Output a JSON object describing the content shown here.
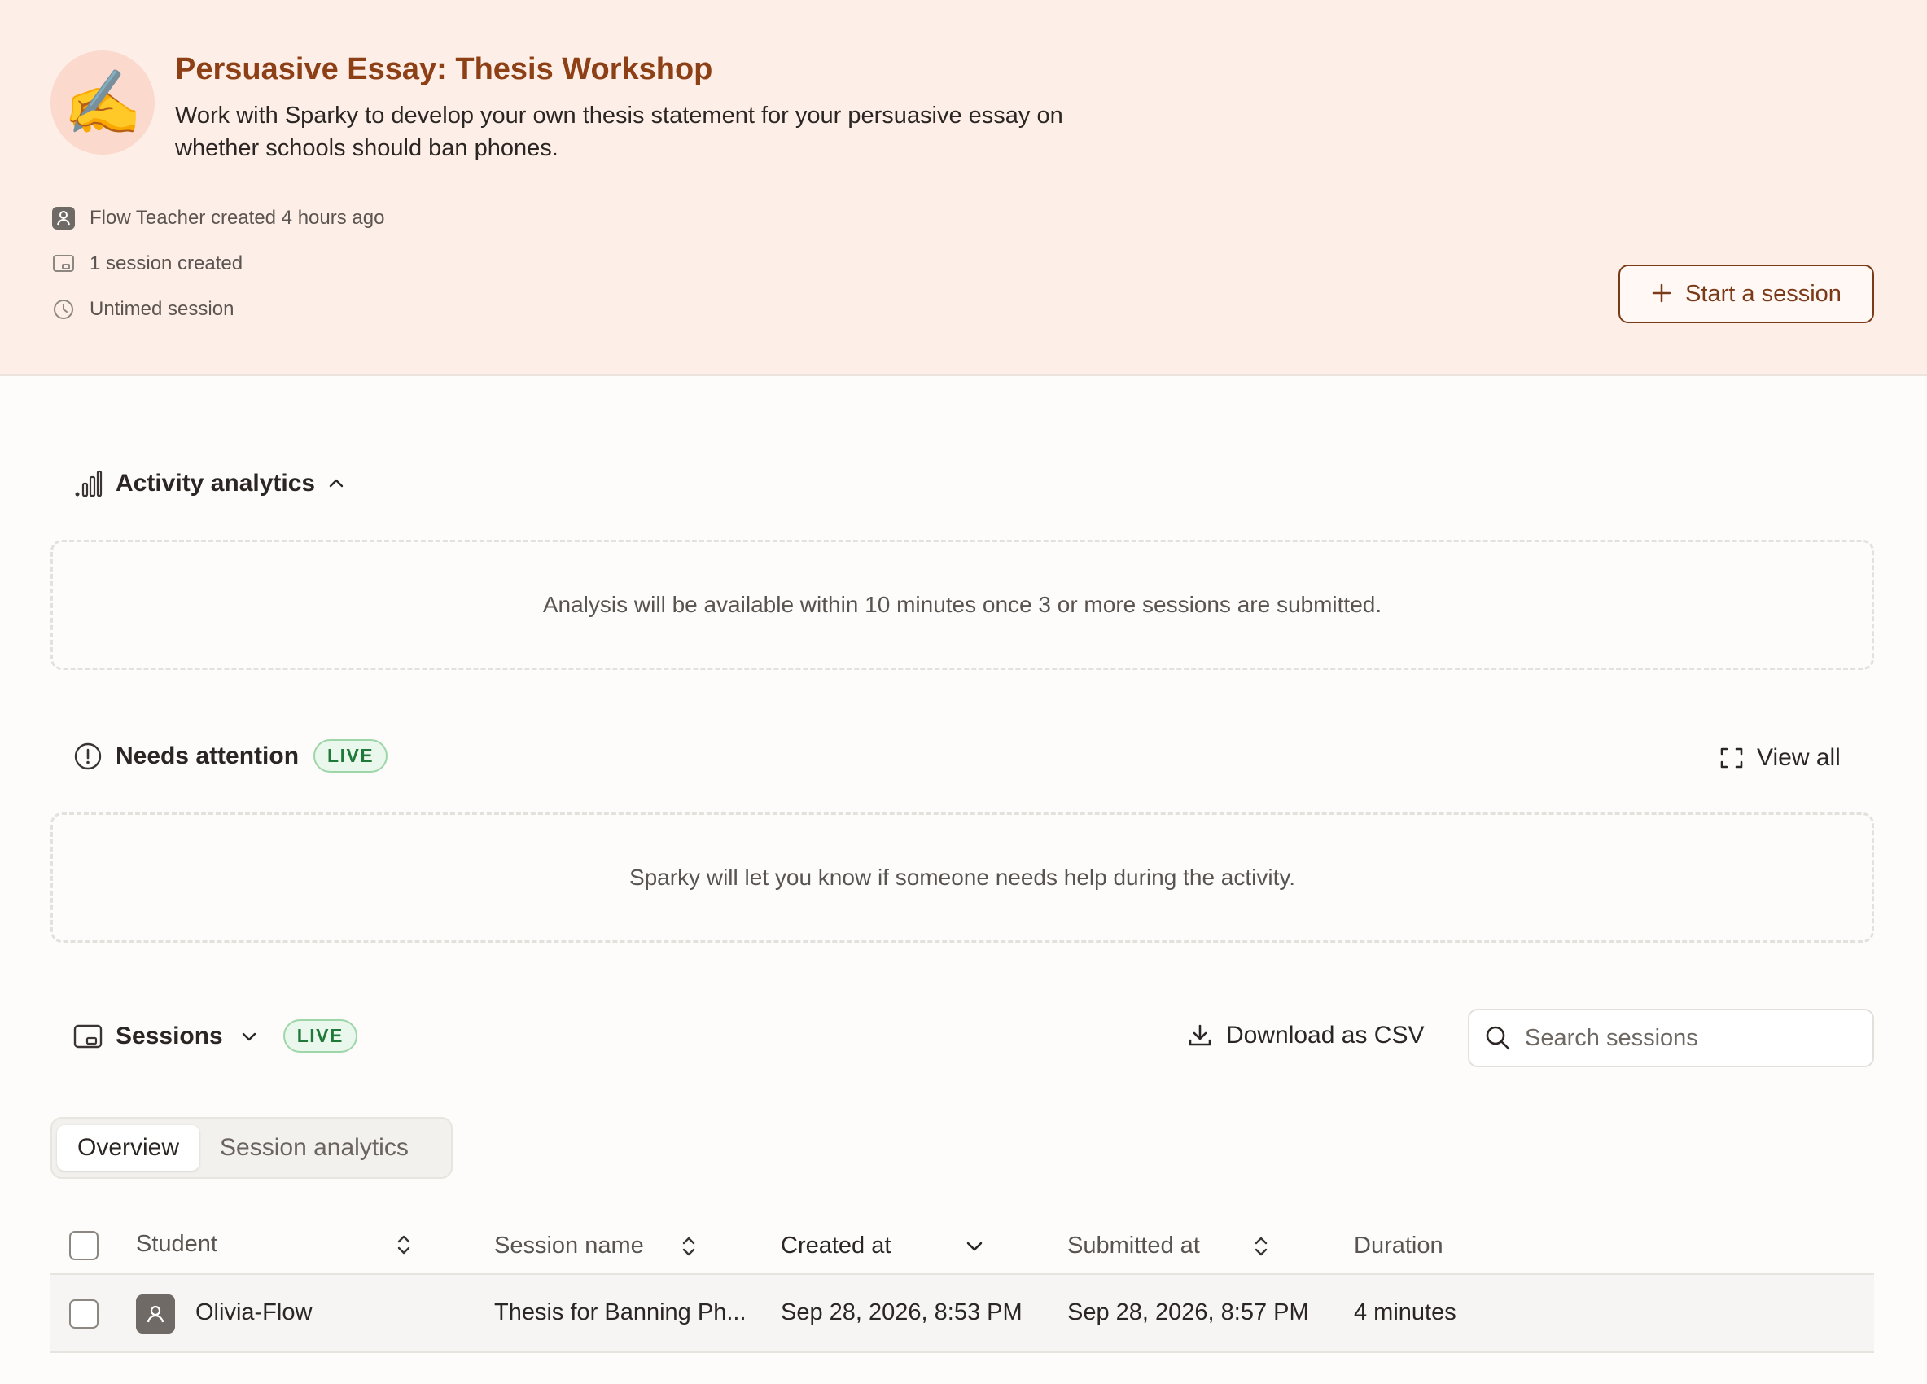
{
  "activity": {
    "emoji": "✍️",
    "title": "Persuasive Essay: Thesis Workshop",
    "description": "Work with Sparky to develop your own thesis statement for your persuasive essay on whether schools should ban phones.",
    "meta": {
      "creator": "Flow Teacher created 4 hours ago",
      "sessions": "1 session created",
      "timing": "Untimed session"
    },
    "start_button": "Start a session"
  },
  "analytics": {
    "heading": "Activity analytics",
    "empty_message": "Analysis will be available within 10 minutes once 3 or more sessions are submitted."
  },
  "attention": {
    "heading": "Needs attention",
    "badge": "LIVE",
    "view_all": "View all",
    "empty_message": "Sparky will let you know if someone needs help during the activity."
  },
  "sessions": {
    "heading": "Sessions",
    "badge": "LIVE",
    "download": "Download as CSV",
    "search_placeholder": "Search sessions",
    "tabs": [
      {
        "label": "Overview",
        "active": true
      },
      {
        "label": "Session analytics",
        "active": false
      }
    ],
    "columns": {
      "student": "Student",
      "session_name": "Session name",
      "created_at": "Created at",
      "submitted_at": "Submitted at",
      "duration": "Duration"
    },
    "rows": [
      {
        "student": "Olivia-Flow",
        "session_name": "Thesis for Banning Ph...",
        "created_at": "Sep 28, 2026, 8:53 PM",
        "submitted_at": "Sep 28, 2026, 8:57 PM",
        "duration": "4 minutes"
      }
    ]
  },
  "colors": {
    "hero_bg": "#fdeee7",
    "title": "#8d3f16",
    "live_green": "#1f7a3a"
  }
}
